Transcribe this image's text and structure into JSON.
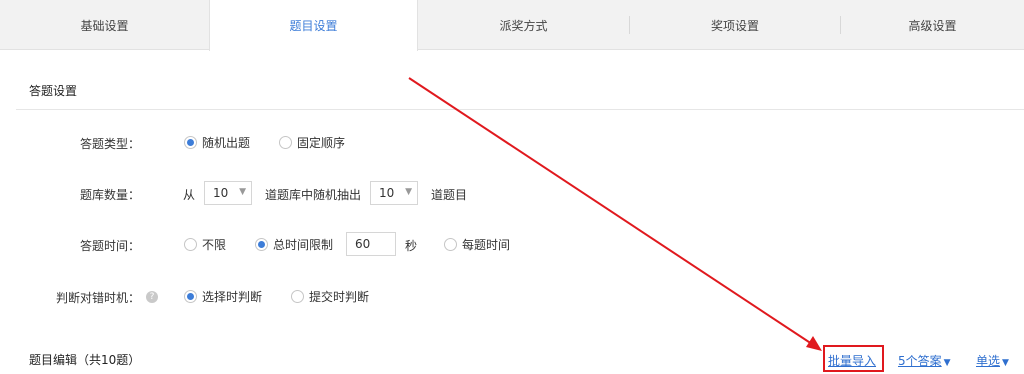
{
  "tabs": [
    {
      "label": "基础设置",
      "active": false
    },
    {
      "label": "题目设置",
      "active": true
    },
    {
      "label": "派奖方式",
      "active": false
    },
    {
      "label": "奖项设置",
      "active": false
    },
    {
      "label": "高级设置",
      "active": false
    }
  ],
  "answer_settings": {
    "section_title": "答题设置",
    "answer_type": {
      "label": "答题类型：",
      "options": [
        {
          "label": "随机出题",
          "checked": true
        },
        {
          "label": "固定顺序",
          "checked": false
        }
      ]
    },
    "bank_count": {
      "label": "题库数量：",
      "prefix": "从",
      "from_value": "10",
      "middle": "道题库中随机抽出",
      "draw_value": "10",
      "suffix": "道题目"
    },
    "answer_time": {
      "label": "答题时间：",
      "options": [
        {
          "label": "不限",
          "checked": false
        },
        {
          "label": "总时间限制",
          "checked": true
        },
        {
          "label": "每题时间",
          "checked": false
        }
      ],
      "total_seconds": "60",
      "unit": "秒"
    },
    "judge_timing": {
      "label": "判断对错时机：",
      "help_icon": "question-circle",
      "options": [
        {
          "label": "选择时判断",
          "checked": true
        },
        {
          "label": "提交时判断",
          "checked": false
        }
      ]
    }
  },
  "question_editor": {
    "title": "题目编辑（共10题）",
    "batch_import": "批量导入",
    "answer_count": "5个答案",
    "choice_type": "单选"
  },
  "colors": {
    "accent": "#3d7dd8",
    "link": "#2f6fcf",
    "annotation_red": "#e0191e",
    "tab_bar": "#f2f2f2"
  }
}
